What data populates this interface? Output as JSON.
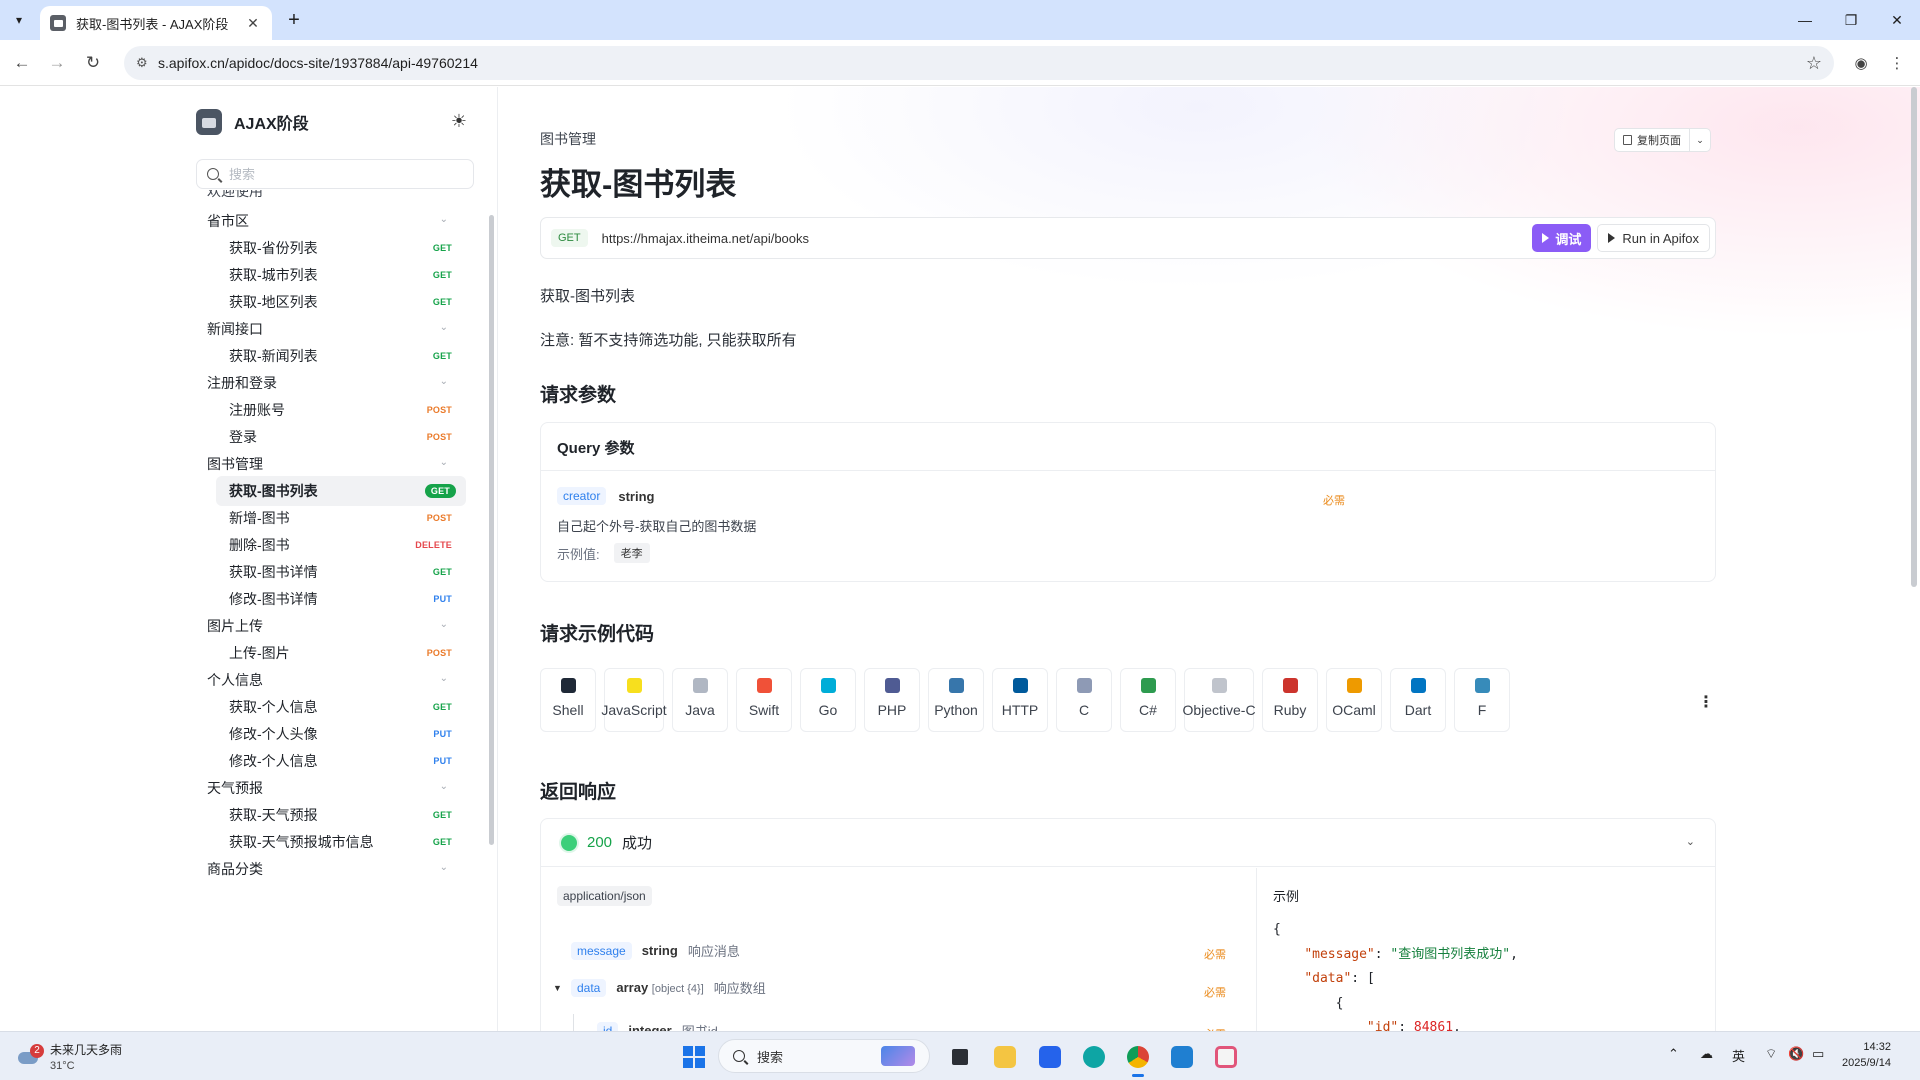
{
  "browser": {
    "tab_title": "获取-图书列表 - AJAX阶段",
    "url": "s.apifox.cn/apidoc/docs-site/1937884/api-49760214",
    "window_controls": [
      "minimize-icon",
      "restore-icon",
      "close-icon"
    ]
  },
  "sidebar": {
    "project_name": "AJAX阶段",
    "search_placeholder": "搜索",
    "partial_top_item": "欢迎使用",
    "groups": [
      {
        "label": "省市区",
        "items": [
          {
            "label": "获取-省份列表",
            "method": "GET"
          },
          {
            "label": "获取-城市列表",
            "method": "GET"
          },
          {
            "label": "获取-地区列表",
            "method": "GET"
          }
        ]
      },
      {
        "label": "新闻接口",
        "items": [
          {
            "label": "获取-新闻列表",
            "method": "GET"
          }
        ]
      },
      {
        "label": "注册和登录",
        "items": [
          {
            "label": "注册账号",
            "method": "POST"
          },
          {
            "label": "登录",
            "method": "POST"
          }
        ]
      },
      {
        "label": "图书管理",
        "items": [
          {
            "label": "获取-图书列表",
            "method": "GET",
            "active": true
          },
          {
            "label": "新增-图书",
            "method": "POST"
          },
          {
            "label": "删除-图书",
            "method": "DELETE"
          },
          {
            "label": "获取-图书详情",
            "method": "GET"
          },
          {
            "label": "修改-图书详情",
            "method": "PUT"
          }
        ]
      },
      {
        "label": "图片上传",
        "items": [
          {
            "label": "上传-图片",
            "method": "POST"
          }
        ]
      },
      {
        "label": "个人信息",
        "items": [
          {
            "label": "获取-个人信息",
            "method": "GET"
          },
          {
            "label": "修改-个人头像",
            "method": "PUT"
          },
          {
            "label": "修改-个人信息",
            "method": "PUT"
          }
        ]
      },
      {
        "label": "天气预报",
        "items": [
          {
            "label": "获取-天气预报",
            "method": "GET"
          },
          {
            "label": "获取-天气预报城市信息",
            "method": "GET"
          }
        ]
      },
      {
        "label": "商品分类",
        "items": []
      }
    ]
  },
  "main": {
    "breadcrumb": "图书管理",
    "copy_page_label": "复制页面",
    "title": "获取-图书列表",
    "method": "GET",
    "endpoint_url": "https://hmajax.itheima.net/api/books",
    "debug_label": "调试",
    "run_label": "Run in Apifox",
    "description": "获取-图书列表",
    "note": "注意: 暂不支持筛选功能, 只能获取所有",
    "request_params_title": "请求参数",
    "query": {
      "title": "Query 参数",
      "param_name": "creator",
      "param_type": "string",
      "required_label": "必需",
      "param_desc": "自己起个外号-获取自己的图书数据",
      "example_label": "示例值:",
      "example_value": "老李"
    },
    "code_examples_title": "请求示例代码",
    "code_tabs": [
      {
        "label": "Shell",
        "icon": "terminal-icon",
        "color": "#1f2937"
      },
      {
        "label": "JavaScript",
        "icon": "javascript-icon",
        "color": "#f7df1e"
      },
      {
        "label": "Java",
        "icon": "java-icon",
        "color": "#b0b7c3"
      },
      {
        "label": "Swift",
        "icon": "swift-icon",
        "color": "#f05138"
      },
      {
        "label": "Go",
        "icon": "go-icon",
        "color": "#00add8"
      },
      {
        "label": "PHP",
        "icon": "php-icon",
        "color": "#4f5b93"
      },
      {
        "label": "Python",
        "icon": "python-icon",
        "color": "#3776ab"
      },
      {
        "label": "HTTP",
        "icon": "http-icon",
        "color": "#005a9c"
      },
      {
        "label": "C",
        "icon": "c-icon",
        "color": "#8e9ab5"
      },
      {
        "label": "C#",
        "icon": "csharp-icon",
        "color": "#2e9b4f"
      },
      {
        "label": "Objective-C",
        "icon": "objective-c-icon",
        "color": "#c0c4cc"
      },
      {
        "label": "Ruby",
        "icon": "ruby-icon",
        "color": "#cc342d"
      },
      {
        "label": "OCaml",
        "icon": "ocaml-icon",
        "color": "#ee9a00"
      },
      {
        "label": "Dart",
        "icon": "dart-icon",
        "color": "#0175c2"
      },
      {
        "label": "F",
        "icon": "fsharp-icon",
        "color": "#378bba"
      }
    ],
    "response_title": "返回响应",
    "response": {
      "status_code": "200",
      "status_text": "成功",
      "content_type": "application/json",
      "fields": [
        {
          "name": "message",
          "type": "string",
          "desc": "响应消息",
          "required": "必需"
        },
        {
          "name": "data",
          "type": "array",
          "subtype": "[object {4}]",
          "desc": "响应数组",
          "required": "必需"
        },
        {
          "name": "id",
          "type": "integer",
          "desc": "图书id",
          "required": "必需"
        }
      ],
      "example_label": "示例",
      "example_json": {
        "open": "{",
        "message_key": "\"message\"",
        "message_value": "\"查询图书列表成功\"",
        "data_key": "\"data\"",
        "data_open": "[",
        "obj_open": "{",
        "id_key": "\"id\"",
        "id_value": "84861"
      }
    }
  },
  "taskbar": {
    "weather_badge": "2",
    "weather_text": "未来几天多雨",
    "temperature": "31°C",
    "search_label": "搜索",
    "ime": "英",
    "time": "14:32",
    "date": "2025/9/14"
  }
}
